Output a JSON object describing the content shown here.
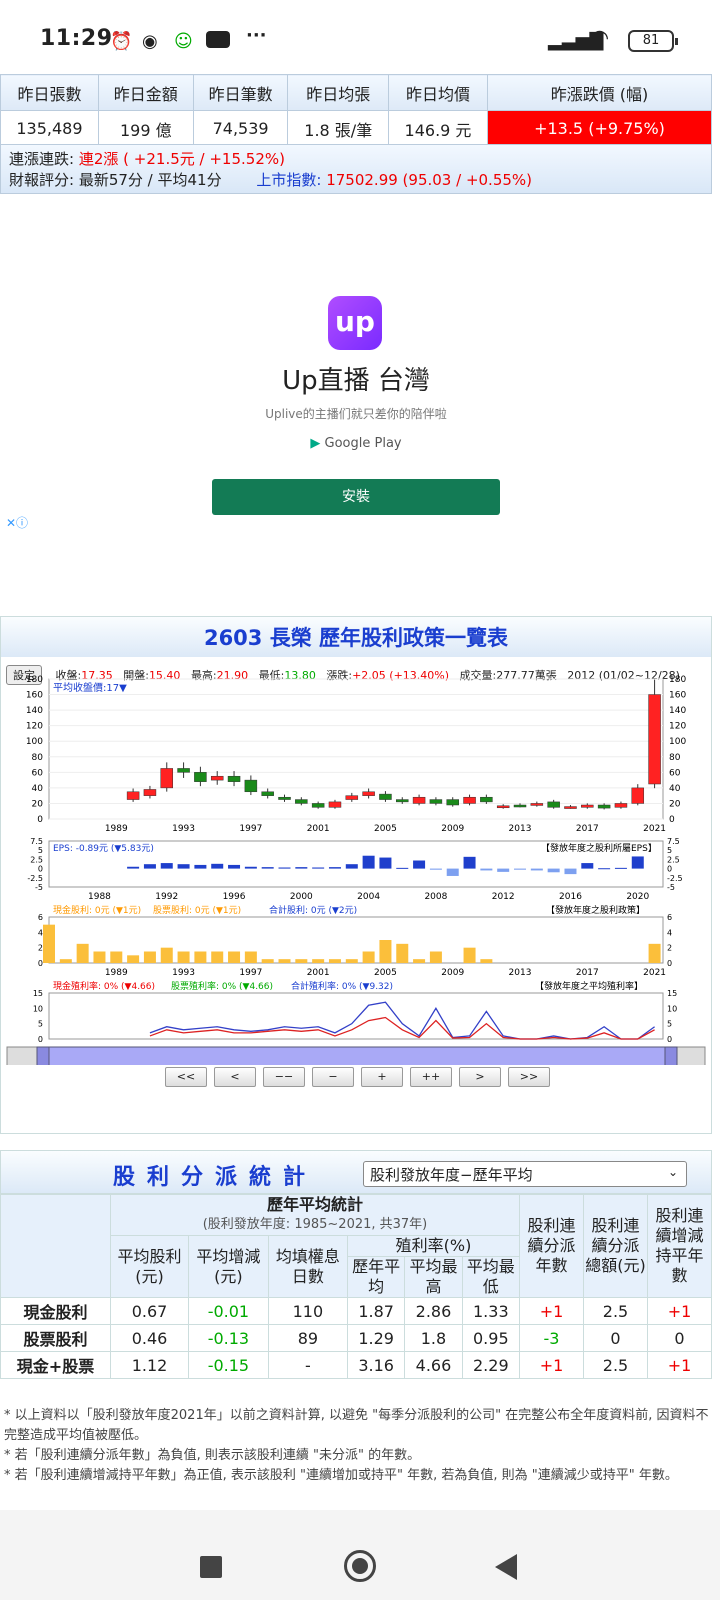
{
  "status_bar": {
    "time": "11:29",
    "battery": "81"
  },
  "summary_table": {
    "headers": [
      "昨日張數",
      "昨日金額",
      "昨日筆數",
      "昨日均張",
      "昨日均價",
      "昨漲跌價 (幅)"
    ],
    "values": [
      "135,489",
      "199 億",
      "74,539",
      "1.8 張/筆",
      "146.9 元",
      "+13.5 (+9.75%)"
    ]
  },
  "summary_lines": {
    "streak_label": "連漲連跌:",
    "streak_value": "連2漲",
    "streak_change": "( +21.5元 / +15.52%)",
    "report_label": "財報評分: 最新57分 / 平均41分",
    "index_label": "上市指數:",
    "index_value": "17502.99 (95.03 / +0.55%)"
  },
  "ad": {
    "logo_text": "up",
    "title": "Up直播 台灣",
    "subtitle": "Uplive的主播们就只差你的陪伴啦",
    "store": "Google Play",
    "install_label": "安裝"
  },
  "dividend_chart": {
    "title": "2603 長榮 歷年股利政策一覽表",
    "settings_label": "設定",
    "close_label": "收盤:",
    "close_value": "17.35",
    "open_label": "開盤:",
    "open_value": "15.40",
    "high_label": "最高:",
    "high_value": "21.90",
    "low_label": "最低:",
    "low_value": "13.80",
    "change_label": "漲跌:",
    "change_value": "+2.05 (+13.40%)",
    "volume_label": "成交量:",
    "volume_value": "277.77萬張",
    "period": "2012 (01/02~12/28)",
    "avg_price_label": "平均收盤價:17▼",
    "eps_label": "EPS: -0.89元 (▼5.83元)",
    "eps_note": "【發放年度之股利所屬EPS】",
    "div_cash_label": "現金股利: 0元 (▼1元)",
    "div_stock_label": "股票股利: 0元 (▼1元)",
    "div_total_label": "合計股利: 0元 (▼2元)",
    "div_note": "【發放年度之股利政策】",
    "yield_cash_label": "現金殖利率: 0% (▼4.66)",
    "yield_stock_label": "股票殖利率: 0% (▼4.66)",
    "yield_total_label": "合計殖利率: 0% (▼9.32)",
    "yield_note": "【發放年度之平均殖利率】",
    "nav_buttons": [
      "<<",
      "<",
      "−−",
      "−",
      "+",
      "++",
      ">",
      ">>"
    ]
  },
  "dividend_stats": {
    "title": "股利分派統計",
    "select_value": "股利發放年度−歷年平均",
    "group_header": "歷年平均統計",
    "group_sub": "(股利發放年度: 1985~2021, 共37年)",
    "col_avg_div": "平均股利(元)",
    "col_avg_chg": "平均增減(元)",
    "col_fill_days": "均填權息日數",
    "yield_header": "殖利率(%)",
    "col_yield_avg": "歷年平均",
    "col_yield_max": "平均最高",
    "col_yield_min": "平均最低",
    "col_streak": "股利連續分派年數",
    "col_total": "股利連續分派總額(元)",
    "col_flat": "股利連續增減持平年數",
    "rows": [
      {
        "name": "現金股利",
        "avg": "0.67",
        "chg": "-0.01",
        "days": "110",
        "yavg": "1.87",
        "ymax": "2.86",
        "ymin": "1.33",
        "streak": "+1",
        "total": "2.5",
        "flat": "+1"
      },
      {
        "name": "股票股利",
        "avg": "0.46",
        "chg": "-0.13",
        "days": "89",
        "yavg": "1.29",
        "ymax": "1.8",
        "ymin": "0.95",
        "streak": "-3",
        "total": "0",
        "flat": "0"
      },
      {
        "name": "現金+股票",
        "avg": "1.12",
        "chg": "-0.15",
        "days": "-",
        "yavg": "3.16",
        "ymax": "4.66",
        "ymin": "2.29",
        "streak": "+1",
        "total": "2.5",
        "flat": "+1"
      }
    ]
  },
  "notes": [
    "* 以上資料以「股利發放年度2021年」以前之資料計算, 以避免 \"每季分派股利的公司\" 在完整公布全年度資料前, 因資料不完整造成平均值被壓低。",
    "* 若「股利連續分派年數」為負值, 則表示該股利連續 \"未分派\" 的年數。",
    "* 若「股利連續增減持平年數」為正值, 表示該股利 \"連續增加或持平\" 年數, 若為負值, 則為 \"連續減少或持平\" 年數。"
  ],
  "chart_data": [
    {
      "type": "candlestick",
      "title": "2603 長榮 歷年股利政策一覽表",
      "x": [
        1990,
        1991,
        1992,
        1993,
        1994,
        1995,
        1996,
        1997,
        1998,
        1999,
        2000,
        2001,
        2002,
        2003,
        2004,
        2005,
        2006,
        2007,
        2008,
        2009,
        2010,
        2011,
        2012,
        2013,
        2014,
        2015,
        2016,
        2017,
        2018,
        2019,
        2020,
        2021
      ],
      "open": [
        25,
        30,
        40,
        65,
        60,
        50,
        55,
        50,
        35,
        28,
        25,
        20,
        15,
        25,
        30,
        32,
        25,
        20,
        25,
        25,
        20,
        28,
        15,
        18,
        18,
        22,
        15,
        15,
        18,
        15,
        20,
        45
      ],
      "close": [
        35,
        38,
        65,
        60,
        48,
        55,
        48,
        35,
        30,
        25,
        20,
        15,
        22,
        30,
        35,
        25,
        22,
        28,
        20,
        18,
        28,
        22,
        17,
        17,
        20,
        15,
        16,
        18,
        14,
        20,
        40,
        160
      ],
      "ylim": [
        0,
        180
      ]
    },
    {
      "type": "bar",
      "series": [
        {
          "name": "EPS",
          "x": [
            1990,
            1991,
            1992,
            1993,
            1994,
            1995,
            1996,
            1997,
            1998,
            1999,
            2000,
            2001,
            2002,
            2003,
            2004,
            2005,
            2006,
            2007,
            2008,
            2009,
            2010,
            2011,
            2012,
            2013,
            2014,
            2015,
            2016,
            2017,
            2018,
            2019,
            2020
          ],
          "values": [
            0.5,
            1.2,
            1.5,
            1.2,
            1.0,
            1.3,
            1.0,
            0.5,
            0.4,
            0.3,
            0.4,
            0.3,
            0.4,
            1.2,
            3.5,
            3.0,
            0.2,
            2.2,
            -0.3,
            -2.0,
            3.2,
            -0.5,
            -0.89,
            -0.3,
            -0.5,
            -1.0,
            -1.5,
            1.5,
            0.1,
            0.2,
            3.3
          ]
        }
      ],
      "ylim": [
        -5,
        7.5
      ]
    },
    {
      "type": "bar",
      "series": [
        {
          "name": "現金股利",
          "x": [
            1985,
            1986,
            1987,
            1988,
            1989,
            1990,
            1991,
            1992,
            1993,
            1994,
            1995,
            1996,
            1997,
            1998,
            1999,
            2000,
            2001,
            2002,
            2003,
            2004,
            2005,
            2006,
            2007,
            2008,
            2009,
            2010,
            2011,
            2012,
            2021
          ],
          "values": [
            5,
            0.5,
            2.5,
            1.5,
            1.5,
            1,
            1.5,
            2,
            1.5,
            1.5,
            1.5,
            1.5,
            1.5,
            0.5,
            0.5,
            0.5,
            0.5,
            0.5,
            0.5,
            1.5,
            3,
            2.5,
            0.5,
            1.5,
            0,
            2,
            0.5,
            0,
            2.5
          ]
        }
      ],
      "ylim": [
        0,
        6
      ]
    },
    {
      "type": "line",
      "series": [
        {
          "name": "合計殖利率",
          "values": [
            2,
            4,
            3,
            3.5,
            4,
            3,
            2.5,
            3,
            4,
            3.5,
            4,
            2,
            5,
            11,
            12,
            5,
            1,
            10,
            0.5,
            1,
            9,
            1,
            0,
            0,
            1,
            0,
            0.5,
            4,
            0,
            0,
            4
          ]
        },
        {
          "name": "現金殖利率",
          "values": [
            1,
            3,
            2,
            2.5,
            3,
            2,
            2,
            2.5,
            3,
            2.5,
            3,
            1,
            3,
            6,
            7,
            3,
            0.5,
            6,
            0.3,
            0.5,
            5,
            0.5,
            0,
            0,
            0.5,
            0,
            0.3,
            2,
            0,
            0,
            3
          ]
        }
      ],
      "ylim": [
        0,
        15
      ]
    }
  ]
}
